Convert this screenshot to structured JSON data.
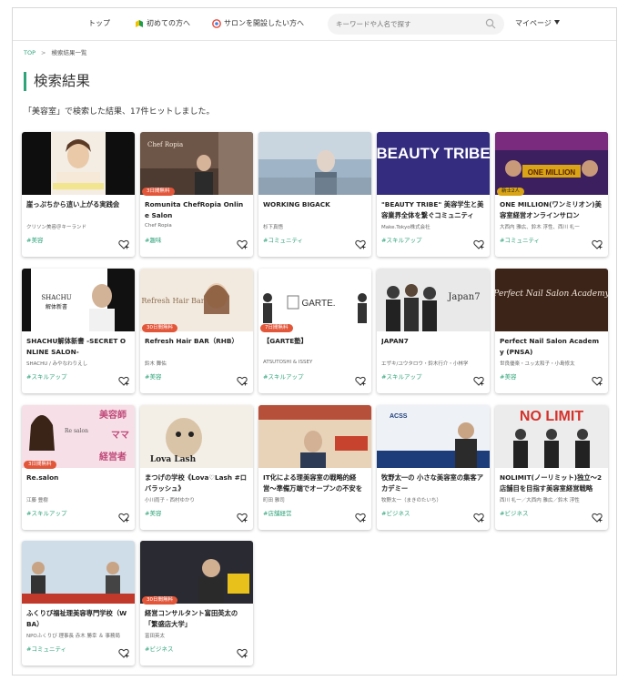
{
  "nav": {
    "top": "トップ",
    "beginners": "初めての方へ",
    "open_salon": "サロンを開設したい方へ",
    "search_placeholder": "キーワードや人名で探す",
    "mypage": "マイページ"
  },
  "breadcrumb": {
    "top": "TOP",
    "current": "検索結果一覧"
  },
  "page_title": "検索結果",
  "result_text": "「美容室」で検索した結果、17件ヒットしました。",
  "thumbnails": {
    "c2": "Chef Ropia",
    "c4": "BEAUTY TRIBE",
    "c5": "ONE MILLION",
    "c6_logo": "SHACHU",
    "c6_sub": "解体新書",
    "c7": "Refresh Hair Bar",
    "c8": "GARTE.",
    "c9": "Japan7",
    "c10": "Perfect Nail Salon Academy",
    "c11_a": "美容師",
    "c11_b": "ママ",
    "c11_c": "経営者",
    "c11_d": "Re salon",
    "c12": "Lova Lash",
    "c14": "ACSS",
    "c15": "NO LIMIT"
  },
  "cards": [
    {
      "title": "崖っぷちから這い上がる実践会",
      "owner": "クリソン美容＠キーランド",
      "tag": "#美容",
      "badge": ""
    },
    {
      "title": "Romunita ChefRopia Online Salon",
      "owner": "Chef Ropia",
      "tag": "#趣味",
      "badge": "3日間無料"
    },
    {
      "title": "WORKING BIGACK",
      "owner": "杉下真悟",
      "tag": "#コミュニティ",
      "badge": ""
    },
    {
      "title": "\"BEAUTY TRIBE\" 美容学生と美容業界全体を繋ぐコミュニティ",
      "owner": "Make.Tokyo株式会社",
      "tag": "#スキルアップ",
      "badge": ""
    },
    {
      "title": "ONE MILLION(ワンミリオン)美容室経営オンラインサロン",
      "owner": "大西内 雅広、鈴木 浮性、西川 礼一",
      "tag": "#コミュニティ",
      "badge": "新士2人"
    },
    {
      "title": "SHACHU解体新書 -SECRET ONLINE SALON-",
      "owner": "SHACHU / みやなわりえし",
      "tag": "#スキルアップ",
      "badge": ""
    },
    {
      "title": "Refresh Hair BAR（RHB）",
      "owner": "鈴木 舞佑",
      "tag": "#美容",
      "badge": "30日間無料"
    },
    {
      "title": "【GARTE塾】",
      "owner": "ATSUTOSHI & ISSEY",
      "tag": "#スキルアップ",
      "badge": "7日間無料"
    },
    {
      "title": "JAPAN7",
      "owner": "エザキ/ユウタロウ・鈴木行介・小林学",
      "tag": "#スキルアップ",
      "badge": ""
    },
    {
      "title": "Perfect Nail Salon Academy (PNSA)",
      "owner": "世良優楽・ユッ太和子・小島修太",
      "tag": "#美容",
      "badge": ""
    },
    {
      "title": "Re.salon",
      "owner": "江藤 豊樹",
      "tag": "#スキルアップ",
      "badge": "3日間無料"
    },
    {
      "title": "まつげの学校《Lova♡Lash #ロバラッシュ》",
      "owner": "小川雨子・西村ゆかり",
      "tag": "#美容",
      "badge": ""
    },
    {
      "title": "IT化による理美容室の戦略的経営〜準備万端でオープンの不安を",
      "owner": "町田 雅司",
      "tag": "#店舗経営",
      "badge": ""
    },
    {
      "title": "牧野太一の 小さな美容室の集客アカデミー",
      "owner": "牧野太一（まきのたいち）",
      "tag": "#ビジネス",
      "badge": ""
    },
    {
      "title": "NOLIMIT(ノーリミット)独立〜2店舗目を目指す美容室経営戦略",
      "owner": "西川 礼一／大西内 雅広／鈴木 浮性",
      "tag": "#ビジネス",
      "badge": ""
    },
    {
      "title": "ふくりび福祉理美容専門学校（WBA）",
      "owner": "NPOふくりび 理事長 赤木 勝幸 ＆ 事務局",
      "tag": "#コミュニティ",
      "badge": ""
    },
    {
      "title": "経営コンサルタント富田英太の「繁盛店大学」",
      "owner": "富田英太",
      "tag": "#ビジネス",
      "badge": "30日間無料"
    }
  ]
}
